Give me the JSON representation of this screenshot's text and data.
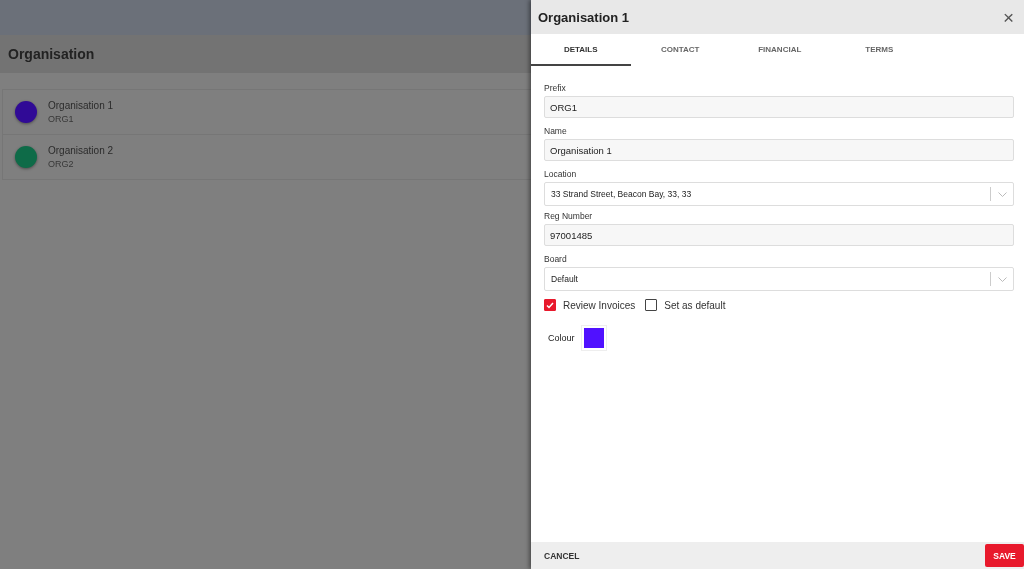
{
  "page": {
    "title": "Organisation"
  },
  "organisations": [
    {
      "name": "Organisation 1",
      "code": "ORG1",
      "color": "#300a96"
    },
    {
      "name": "Organisation 2",
      "code": "ORG2",
      "color": "#0e6b48"
    }
  ],
  "drawer": {
    "title": "Organisation 1",
    "close": "×",
    "tabs": [
      {
        "label": "DETAILS",
        "selected": true
      },
      {
        "label": "CONTACT",
        "selected": false
      },
      {
        "label": "FINANCIAL",
        "selected": false
      },
      {
        "label": "TERMS",
        "selected": false
      }
    ],
    "fields": [
      {
        "kind": "text",
        "label": "Prefix",
        "value": "ORG1"
      },
      {
        "kind": "text",
        "label": "Name",
        "value": "Organisation 1"
      },
      {
        "kind": "select",
        "label": "Location",
        "value": "33 Strand Street, Beacon Bay, 33, 33"
      },
      {
        "kind": "text",
        "label": "Reg Number",
        "value": "97001485"
      },
      {
        "kind": "select",
        "label": "Board",
        "value": "Default"
      }
    ],
    "checkboxes": [
      {
        "label": "Review Invoices",
        "checked": true
      },
      {
        "label": "Set as default",
        "checked": false
      }
    ],
    "colour": {
      "label": "Colour",
      "color": "#5011ff"
    },
    "cancel": "CANCEL",
    "save": "SAVE"
  }
}
